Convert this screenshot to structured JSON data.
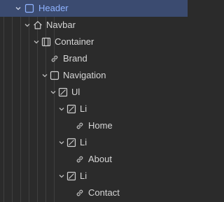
{
  "navigator": {
    "rows": [
      {
        "label": "Header",
        "icon": "box-icon",
        "expanded": true,
        "selected": true
      },
      {
        "label": "Navbar",
        "icon": "navbar-icon",
        "expanded": true
      },
      {
        "label": "Container",
        "icon": "container-icon",
        "expanded": true
      },
      {
        "label": "Brand",
        "icon": "link-icon"
      },
      {
        "label": "Navigation",
        "icon": "box-icon",
        "expanded": true
      },
      {
        "label": "Ul",
        "icon": "list-icon",
        "expanded": true
      },
      {
        "label": "Li",
        "icon": "list-icon",
        "expanded": true
      },
      {
        "label": "Home",
        "icon": "link-icon"
      },
      {
        "label": "Li",
        "icon": "list-icon",
        "expanded": true
      },
      {
        "label": "About",
        "icon": "link-icon"
      },
      {
        "label": "Li",
        "icon": "list-icon",
        "expanded": true
      },
      {
        "label": "Contact",
        "icon": "link-icon"
      }
    ]
  },
  "colors": {
    "background": "#2b2b2b",
    "selected_row": "#3b4b70",
    "selected_text": "#8fb3ff",
    "text": "#d6d6d6"
  }
}
